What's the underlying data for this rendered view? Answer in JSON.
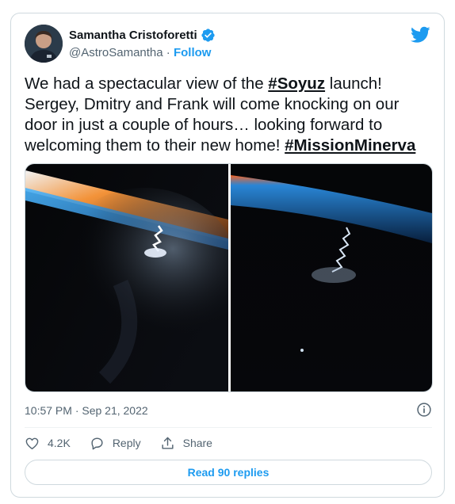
{
  "author": {
    "name": "Samantha Cristoforetti",
    "handle": "@AstroSamantha",
    "separator": "·",
    "follow_label": "Follow",
    "verified": true
  },
  "tweet": {
    "text_part1": "We had a spectacular view of the ",
    "hashtag1": "#Soyuz",
    "text_part2": " launch! Sergey, Dmitry and Frank will come knocking on our door in just a couple of hours… looking forward to welcoming them to their new home! ",
    "hashtag2": "#MissionMinerva"
  },
  "media": {
    "count": 2,
    "description_icons": [
      "earth-horizon-photo",
      "rocket-launch-photo"
    ]
  },
  "meta": {
    "timestamp": "10:57 PM · Sep 21, 2022"
  },
  "actions": {
    "like_count": "4.2K",
    "reply_label": "Reply",
    "share_label": "Share"
  },
  "read_replies_label": "Read 90 replies",
  "colors": {
    "accent": "#1d9bf0",
    "text": "#0f1419",
    "muted": "#536471",
    "border": "#cfd9de"
  }
}
